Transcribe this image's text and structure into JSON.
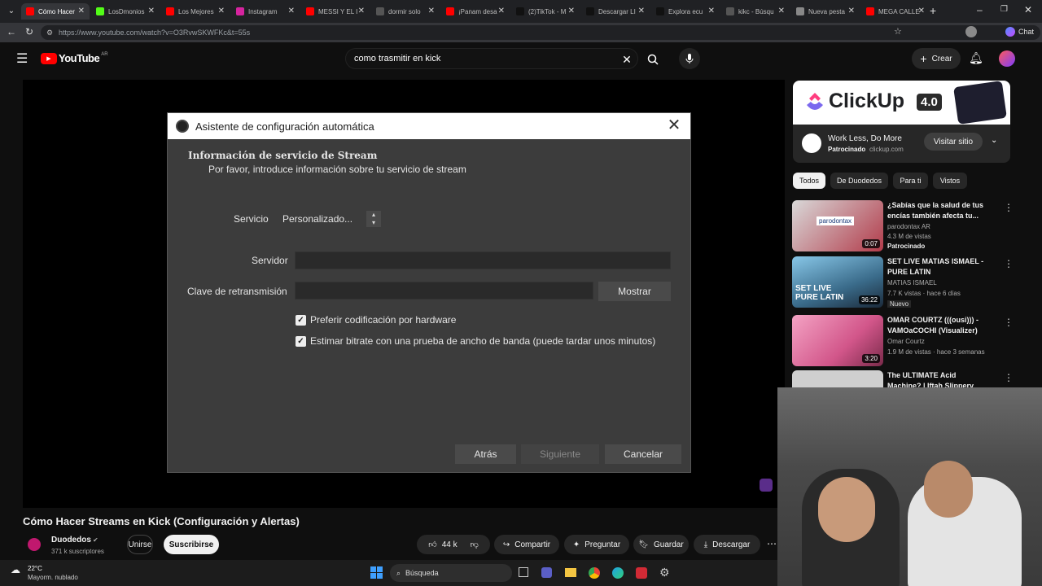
{
  "browser": {
    "tabs": [
      {
        "label": "Cómo Hacer",
        "active": true,
        "fav": "youtube"
      },
      {
        "label": "LosDmonios",
        "fav": "kick"
      },
      {
        "label": "Los Mejores",
        "fav": "youtube"
      },
      {
        "label": "Instagram",
        "fav": "instagram"
      },
      {
        "label": "MESSI Y EL I",
        "fav": "youtube"
      },
      {
        "label": "dormir solo",
        "fav": "search"
      },
      {
        "label": "¡Panam desa",
        "fav": "youtube"
      },
      {
        "label": "(2)TikTok - M",
        "fav": "tiktok"
      },
      {
        "label": "Descargar LI",
        "fav": "tiktok"
      },
      {
        "label": "Explora ecu",
        "fav": "tiktok"
      },
      {
        "label": "kikc - Búsqu",
        "fav": "search"
      },
      {
        "label": "Nueva pesta",
        "fav": "page"
      },
      {
        "label": "MEGA CALLE",
        "fav": "youtube"
      }
    ],
    "url": "https://www.youtube.com/watch?v=O3RvwSKWFKc&t=55s",
    "chat_label": "Chat"
  },
  "youtube": {
    "logo_text": "YouTube",
    "country": "AR",
    "search_value": "como trasmitir en kick",
    "create_label": "Crear"
  },
  "dialog": {
    "title": "Asistente de configuración automática",
    "heading": "Información de servicio de Stream",
    "subheading": "Por favor, introduce información sobre tu servicio de stream",
    "service_label": "Servicio",
    "service_value": "Personalizado...",
    "server_label": "Servidor",
    "server_value": "",
    "key_label": "Clave de retransmisión",
    "key_value": "",
    "show_label": "Mostrar",
    "hw_label": "Preferir codificación por hardware",
    "hw_checked": true,
    "bitrate_label": "Estimar bitrate con una prueba de ancho de banda (puede tardar unos minutos)",
    "bitrate_checked": true,
    "back_label": "Atrás",
    "next_label": "Siguiente",
    "cancel_label": "Cancelar"
  },
  "video": {
    "title": "Cómo Hacer Streams en Kick (Configuración y Alertas)",
    "channel": "Duodedos",
    "subscribers": "371 k suscriptores",
    "join_label": "Unirse",
    "subscribe_label": "Suscribirse",
    "likes": "44 k",
    "share_label": "Compartir",
    "ask_label": "Preguntar",
    "save_label": "Guardar",
    "download_label": "Descargar"
  },
  "ad": {
    "brand": "ClickUp",
    "version": "4.0",
    "headline": "Work Less, Do More",
    "sponsored": "Patrocinado",
    "domain": "clickup.com",
    "visit_label": "Visitar sitio"
  },
  "chips": [
    "Todos",
    "De Duodedos",
    "Para ti",
    "Vistos"
  ],
  "recommendations": [
    {
      "title": "¿Sabías que la salud de tus encías también afecta tu...",
      "channel": "parodontax AR",
      "meta": "4.3 M de vistas",
      "badge": "Patrocinado",
      "duration": "0:07",
      "thumb_text": "parodontax"
    },
    {
      "title": "SET LIVE MATIAS ISMAEL - PURE LATIN",
      "channel": "MATIAS ISMAEL",
      "meta": "7.7 K vistas · hace 6 días",
      "badge": "Nuevo",
      "duration": "36:22",
      "thumb_text": "SET LIVE PURE LATIN"
    },
    {
      "title": "OMAR COURTZ (((ousi))) - VAMOaCOCHI (Visualizer)",
      "channel": "Omar Courtz",
      "meta": "1.9 M de vistas · hace 3 semanas",
      "badge": "",
      "duration": "3:20",
      "thumb_text": ""
    },
    {
      "title": "The ULTIMATE Acid Machine? | Iftah Slippery Slope",
      "channel": "",
      "meta": "",
      "badge": "",
      "duration": "",
      "thumb_text": ""
    }
  ],
  "taskbar": {
    "temperature": "22°C",
    "weather": "Mayorm. nublado",
    "search_label": "Búsqueda"
  },
  "colors": {
    "yt_red": "#ff0000",
    "clickup_purple": "#7b68ee",
    "dialog_bg": "#3c3c3c"
  }
}
